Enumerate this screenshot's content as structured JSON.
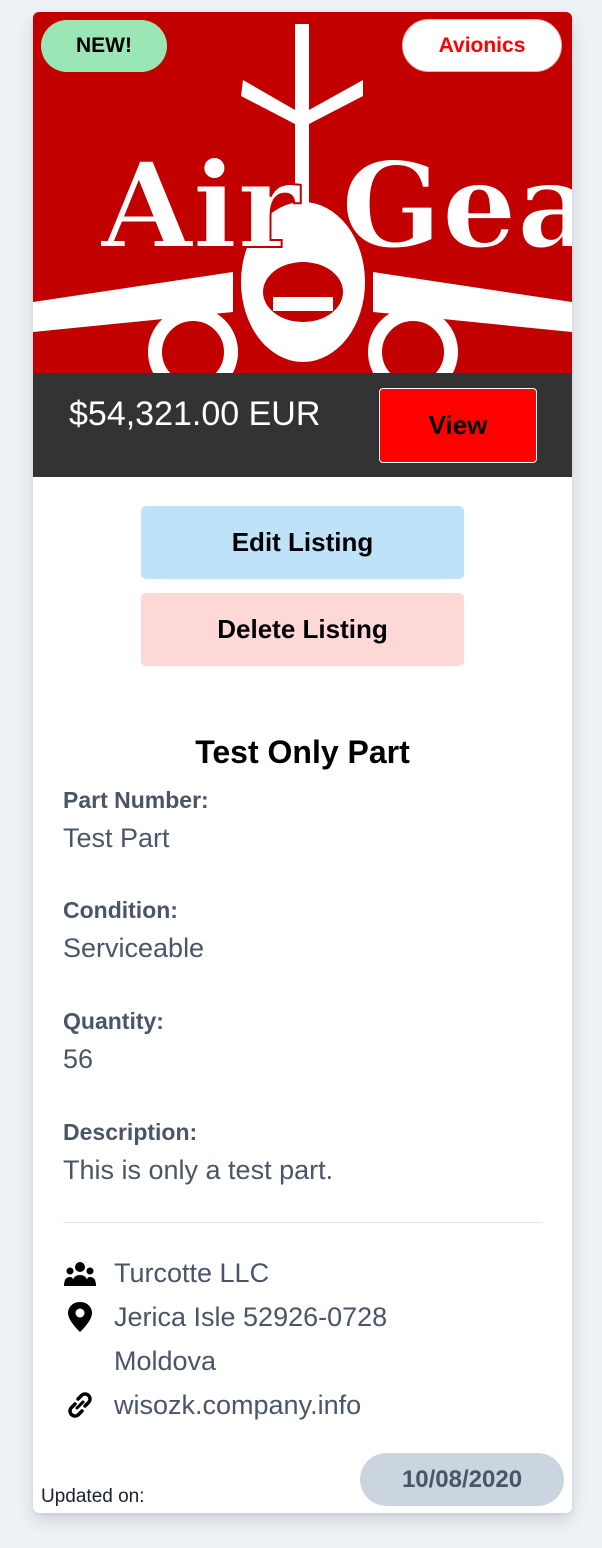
{
  "listing": {
    "banner_logo_text_left": "Air",
    "banner_logo_text_right": "Gear",
    "badge_new": "NEW!",
    "category": "Avionics",
    "price": "$54,321.00 EUR",
    "view_label": "View",
    "edit_label": "Edit Listing",
    "delete_label": "Delete Listing",
    "title": "Test Only Part",
    "fields": [
      {
        "label": "Part Number:",
        "value": "Test Part"
      },
      {
        "label": "Condition:",
        "value": "Serviceable"
      },
      {
        "label": "Quantity:",
        "value": "56"
      },
      {
        "label": "Description:",
        "value": "This is only a test part."
      }
    ],
    "company": {
      "name": "Turcotte LLC",
      "address_line1": "Jerica Isle 52926-0728",
      "address_line2": "Moldova",
      "website": "wisozk.company.info"
    },
    "updated_label": "Updated on:",
    "updated_date": "10/08/2020"
  },
  "icons": {
    "company": "users-icon",
    "location": "map-pin-icon",
    "website": "link-icon"
  },
  "colors": {
    "banner": "#c20000",
    "price_bar": "#333333",
    "view_button": "#ff0000",
    "badge_new": "#9ae6b4",
    "edit_button": "#bee3f8",
    "delete_button": "#fed7d7",
    "date_badge": "#cbd5e0"
  }
}
